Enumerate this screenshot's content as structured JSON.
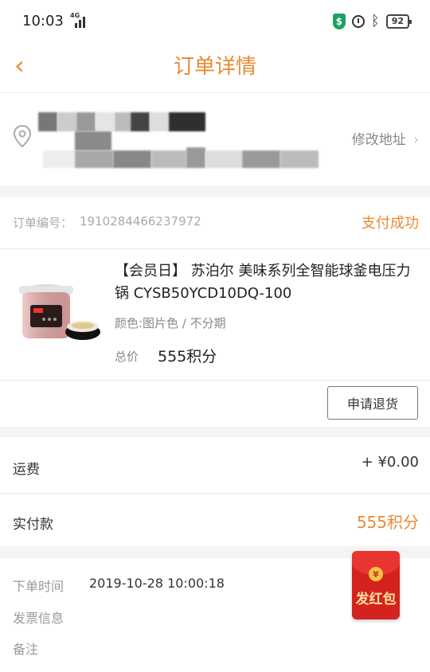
{
  "status_bar": {
    "time": "10:03",
    "network": "4G",
    "battery": "92"
  },
  "nav": {
    "title": "订单详情"
  },
  "address": {
    "edit_label": "修改地址",
    "chevron": "›"
  },
  "order": {
    "number_label": "订单编号：",
    "number": "1910284466237972",
    "status": "支付成功"
  },
  "product": {
    "title": "【会员日】 苏泊尔 美味系列全智能球釜电压力锅 CYSB50YCD10DQ-100",
    "spec": "颜色:图片色 / 不分期",
    "total_label": "总价",
    "total": "555积分"
  },
  "actions": {
    "refund_label": "申请退货"
  },
  "fees": {
    "shipping_label": "运费",
    "shipping_value": "+ ¥0.00",
    "paid_label": "实付款",
    "paid_value": "555积分"
  },
  "info": {
    "order_time_label": "下单时间",
    "order_time": "2019-10-28 10:00:18",
    "invoice_label": "发票信息",
    "note_label": "备注"
  },
  "red_packet": {
    "label": "发红包",
    "coin": "¥"
  },
  "colors": {
    "accent": "#e98a34",
    "red": "#d4231e"
  }
}
